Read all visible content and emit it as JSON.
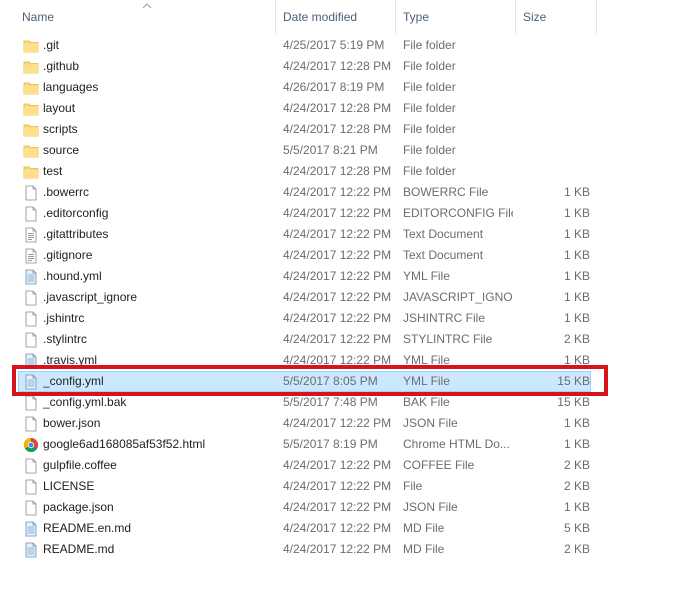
{
  "columns": {
    "name": "Name",
    "date": "Date modified",
    "type": "Type",
    "size": "Size"
  },
  "files": [
    {
      "name": ".git",
      "date": "4/25/2017 5:19 PM",
      "type": "File folder",
      "size": "",
      "icon": "folder-icon"
    },
    {
      "name": ".github",
      "date": "4/24/2017 12:28 PM",
      "type": "File folder",
      "size": "",
      "icon": "folder-icon"
    },
    {
      "name": "languages",
      "date": "4/26/2017 8:19 PM",
      "type": "File folder",
      "size": "",
      "icon": "folder-icon"
    },
    {
      "name": "layout",
      "date": "4/24/2017 12:28 PM",
      "type": "File folder",
      "size": "",
      "icon": "folder-icon"
    },
    {
      "name": "scripts",
      "date": "4/24/2017 12:28 PM",
      "type": "File folder",
      "size": "",
      "icon": "folder-icon"
    },
    {
      "name": "source",
      "date": "5/5/2017 8:21 PM",
      "type": "File folder",
      "size": "",
      "icon": "folder-icon"
    },
    {
      "name": "test",
      "date": "4/24/2017 12:28 PM",
      "type": "File folder",
      "size": "",
      "icon": "folder-icon"
    },
    {
      "name": ".bowerrc",
      "date": "4/24/2017 12:22 PM",
      "type": "BOWERRC File",
      "size": "1 KB",
      "icon": "blank-file-icon"
    },
    {
      "name": ".editorconfig",
      "date": "4/24/2017 12:22 PM",
      "type": "EDITORCONFIG File",
      "size": "1 KB",
      "icon": "blank-file-icon"
    },
    {
      "name": ".gitattributes",
      "date": "4/24/2017 12:22 PM",
      "type": "Text Document",
      "size": "1 KB",
      "icon": "text-file-icon"
    },
    {
      "name": ".gitignore",
      "date": "4/24/2017 12:22 PM",
      "type": "Text Document",
      "size": "1 KB",
      "icon": "text-file-icon"
    },
    {
      "name": ".hound.yml",
      "date": "4/24/2017 12:22 PM",
      "type": "YML File",
      "size": "1 KB",
      "icon": "yml-file-icon"
    },
    {
      "name": ".javascript_ignore",
      "date": "4/24/2017 12:22 PM",
      "type": "JAVASCRIPT_IGNO...",
      "size": "1 KB",
      "icon": "blank-file-icon"
    },
    {
      "name": ".jshintrc",
      "date": "4/24/2017 12:22 PM",
      "type": "JSHINTRC File",
      "size": "1 KB",
      "icon": "blank-file-icon"
    },
    {
      "name": ".stylintrc",
      "date": "4/24/2017 12:22 PM",
      "type": "STYLINTRC File",
      "size": "2 KB",
      "icon": "blank-file-icon"
    },
    {
      "name": ".travis.yml",
      "date": "4/24/2017 12:22 PM",
      "type": "YML File",
      "size": "1 KB",
      "icon": "yml-file-icon"
    },
    {
      "name": "_config.yml",
      "date": "5/5/2017 8:05 PM",
      "type": "YML File",
      "size": "15 KB",
      "icon": "yml-file-icon",
      "selected": true
    },
    {
      "name": "_config.yml.bak",
      "date": "5/5/2017 7:48 PM",
      "type": "BAK File",
      "size": "15 KB",
      "icon": "blank-file-icon"
    },
    {
      "name": "bower.json",
      "date": "4/24/2017 12:22 PM",
      "type": "JSON File",
      "size": "1 KB",
      "icon": "blank-file-icon"
    },
    {
      "name": "google6ad168085af53f52.html",
      "date": "5/5/2017 8:19 PM",
      "type": "Chrome HTML Do...",
      "size": "1 KB",
      "icon": "chrome-icon"
    },
    {
      "name": "gulpfile.coffee",
      "date": "4/24/2017 12:22 PM",
      "type": "COFFEE File",
      "size": "2 KB",
      "icon": "blank-file-icon"
    },
    {
      "name": "LICENSE",
      "date": "4/24/2017 12:22 PM",
      "type": "File",
      "size": "2 KB",
      "icon": "blank-file-icon"
    },
    {
      "name": "package.json",
      "date": "4/24/2017 12:22 PM",
      "type": "JSON File",
      "size": "1 KB",
      "icon": "blank-file-icon"
    },
    {
      "name": "README.en.md",
      "date": "4/24/2017 12:22 PM",
      "type": "MD File",
      "size": "5 KB",
      "icon": "yml-file-icon"
    },
    {
      "name": "README.md",
      "date": "4/24/2017 12:22 PM",
      "type": "MD File",
      "size": "2 KB",
      "icon": "yml-file-icon"
    }
  ],
  "colors": {
    "selection_bg": "#cce8ff",
    "selection_border": "#99d1ff",
    "highlight": "#d8121b",
    "folder": "#f8d775",
    "header_text": "#4c607a"
  }
}
